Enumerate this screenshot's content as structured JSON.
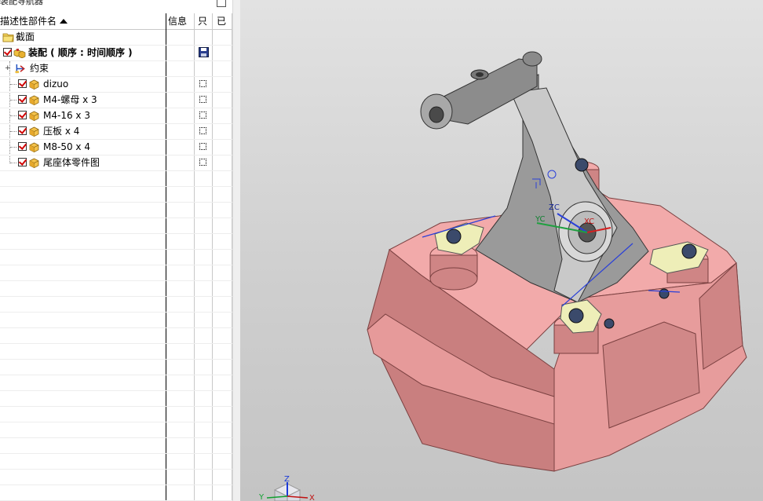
{
  "navigator": {
    "title": "装配导航器",
    "columns": {
      "name": "描述性部件名",
      "info": "信息",
      "readonly": "只",
      "modified": "已"
    },
    "items": [
      {
        "label": "截面",
        "bold": false,
        "indent": 0,
        "icon": "folder-icon",
        "checked": false
      },
      {
        "label": "装配 ( 顺序 : 时间顺序 )",
        "bold": true,
        "indent": 0,
        "icon": "assembly-icon",
        "checked": true
      },
      {
        "label": "约束",
        "bold": false,
        "indent": 1,
        "icon": "constraint-icon",
        "checked": false
      },
      {
        "label": "dizuo",
        "bold": false,
        "indent": 1,
        "icon": "part-cube-icon",
        "checked": true
      },
      {
        "label": "M4-螺母 x 3",
        "bold": false,
        "indent": 1,
        "icon": "part-cube-icon",
        "checked": true
      },
      {
        "label": "M4-16 x 3",
        "bold": false,
        "indent": 1,
        "icon": "part-cube-icon",
        "checked": true
      },
      {
        "label": "压板 x 4",
        "bold": false,
        "indent": 1,
        "icon": "part-cube-icon",
        "checked": true
      },
      {
        "label": "M8-50 x 4",
        "bold": false,
        "indent": 1,
        "icon": "part-cube-icon",
        "checked": true
      },
      {
        "label": "尾座体零件图",
        "bold": false,
        "indent": 1,
        "icon": "part-cube-icon",
        "checked": true
      }
    ]
  },
  "viewport": {
    "csys_labels": {
      "zc": "ZC",
      "yc": "YC",
      "xc": "XC"
    },
    "triad_labels": {
      "z": "Z",
      "y": "Y",
      "x": "X"
    },
    "colors": {
      "base": "#f2a8a8",
      "base_dark": "#c97f7f",
      "bracket": "#9a9a9a",
      "clamp": "#eeeeb8",
      "bolt": "#3b4a6b",
      "axis_blue": "#2a40d8"
    }
  }
}
